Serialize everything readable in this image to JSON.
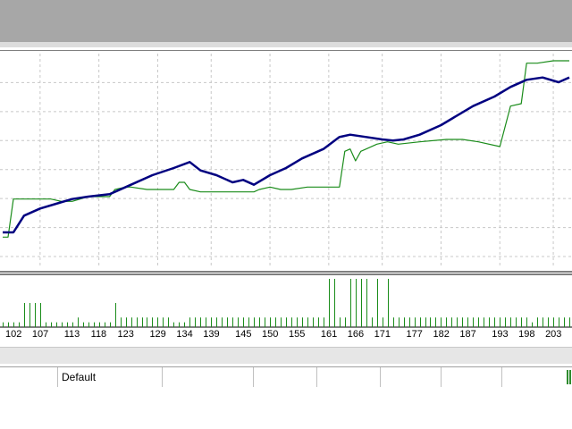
{
  "window": {
    "top_bar_color": "#a7a7a7"
  },
  "chart_data": {
    "type": "line",
    "series": [
      {
        "color": "#000080",
        "x": [
          100,
          102,
          104,
          107,
          110,
          113,
          116,
          120,
          124,
          128,
          132,
          135,
          137,
          140,
          143,
          145,
          147,
          150,
          153,
          156,
          160,
          163,
          165,
          168,
          171,
          173,
          175,
          178,
          182,
          185,
          188,
          192,
          195,
          198,
          201,
          204,
          206
        ],
        "y": [
          2.5,
          2.5,
          3.2,
          3.5,
          3.7,
          3.9,
          4.0,
          4.1,
          4.5,
          4.9,
          5.2,
          5.45,
          5.1,
          4.9,
          4.6,
          4.7,
          4.5,
          4.9,
          5.2,
          5.6,
          6.0,
          6.5,
          6.6,
          6.5,
          6.4,
          6.35,
          6.4,
          6.6,
          7.0,
          7.4,
          7.8,
          8.2,
          8.6,
          8.9,
          9.0,
          8.8,
          9.0
        ]
      },
      {
        "color": "#1a8c1a",
        "x": [
          100,
          101,
          102,
          103,
          106,
          109,
          111,
          113,
          116,
          119,
          120,
          121,
          123,
          124,
          127,
          131,
          132,
          133,
          134,
          135,
          137,
          142,
          145,
          147,
          148,
          150,
          152,
          154,
          157,
          160,
          163,
          164,
          165,
          166,
          167,
          168,
          170,
          172,
          174,
          178,
          183,
          186,
          189,
          193,
          195,
          197,
          198,
          200,
          203,
          206
        ],
        "y": [
          2.3,
          2.3,
          3.9,
          3.9,
          3.9,
          3.9,
          3.8,
          3.8,
          4.0,
          4.0,
          4.0,
          4.3,
          4.4,
          4.4,
          4.3,
          4.3,
          4.3,
          4.6,
          4.6,
          4.3,
          4.2,
          4.2,
          4.2,
          4.2,
          4.3,
          4.4,
          4.3,
          4.3,
          4.4,
          4.4,
          4.4,
          5.9,
          6.0,
          5.5,
          5.9,
          6.0,
          6.2,
          6.3,
          6.2,
          6.3,
          6.4,
          6.4,
          6.3,
          6.1,
          7.8,
          7.9,
          9.6,
          9.6,
          9.7,
          9.7
        ]
      }
    ],
    "xlim": [
      99.5,
      206.5
    ],
    "ylim": [
      1.0,
      10.0
    ],
    "grid": true,
    "x_ticks": [
      "102",
      "107",
      "113",
      "118",
      "123",
      "129",
      "134",
      "139",
      "145",
      "150",
      "155",
      "161",
      "166",
      "171",
      "177",
      "182",
      "187",
      "193",
      "198",
      "203"
    ],
    "volume": {
      "color": "#1a8c1a",
      "x": [
        100,
        101,
        102,
        103,
        104,
        105,
        106,
        107,
        108,
        109,
        110,
        111,
        112,
        113,
        114,
        115,
        116,
        117,
        118,
        119,
        120,
        121,
        122,
        123,
        124,
        125,
        126,
        127,
        128,
        129,
        130,
        131,
        132,
        133,
        134,
        135,
        136,
        137,
        138,
        139,
        140,
        141,
        142,
        143,
        144,
        145,
        146,
        147,
        148,
        149,
        150,
        151,
        152,
        153,
        154,
        155,
        156,
        157,
        158,
        159,
        160,
        161,
        162,
        163,
        164,
        165,
        166,
        167,
        168,
        169,
        170,
        171,
        172,
        173,
        174,
        175,
        176,
        177,
        178,
        179,
        180,
        181,
        182,
        183,
        184,
        185,
        186,
        187,
        188,
        189,
        190,
        191,
        192,
        193,
        194,
        195,
        196,
        197,
        198,
        199,
        200,
        201,
        202,
        203,
        204,
        205,
        206
      ],
      "values": [
        1,
        1,
        1,
        1,
        5,
        5,
        5,
        5,
        1,
        1,
        1,
        1,
        1,
        1,
        2,
        1,
        1,
        1,
        1,
        1,
        1,
        5,
        2,
        2,
        2,
        2,
        2,
        2,
        2,
        2,
        2,
        2,
        1,
        1,
        1,
        2,
        2,
        2,
        2,
        2,
        2,
        2,
        2,
        2,
        2,
        2,
        2,
        2,
        2,
        2,
        2,
        2,
        2,
        2,
        2,
        2,
        2,
        2,
        2,
        2,
        2,
        10,
        10,
        2,
        2,
        10,
        10,
        10,
        10,
        2,
        10,
        2,
        10,
        2,
        2,
        2,
        2,
        2,
        2,
        2,
        2,
        2,
        2,
        2,
        2,
        2,
        2,
        2,
        2,
        2,
        2,
        2,
        2,
        2,
        2,
        2,
        2,
        2,
        2,
        1,
        2,
        2,
        2,
        2,
        2,
        2,
        2
      ],
      "ylim": [
        0,
        10
      ]
    }
  },
  "status_bar": {
    "profile": "Default",
    "cells": [
      "",
      "Default",
      "",
      "",
      "",
      "",
      "",
      "",
      ""
    ]
  }
}
